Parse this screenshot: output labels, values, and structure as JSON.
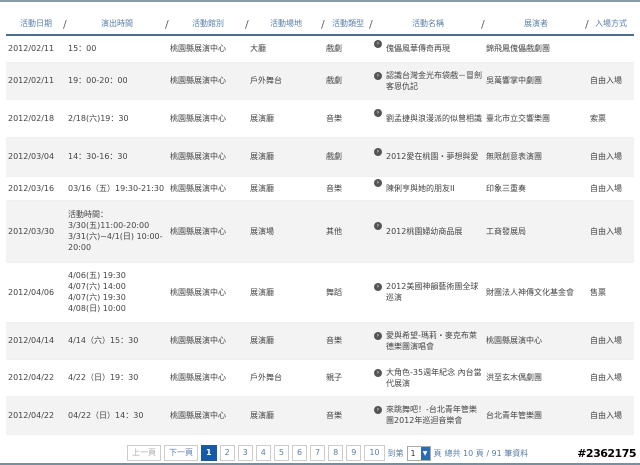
{
  "headers": [
    "活動日期",
    "演出時間",
    "活動館別",
    "活動場地",
    "活動類型",
    "活動名稱",
    "展演者",
    "入場方式"
  ],
  "rows": [
    {
      "date": "2012/02/11",
      "time": "15：00",
      "hall": "桃園縣展演中心",
      "venue": "大廳",
      "type": "戲劇",
      "name": "傀儡風華傳奇再現",
      "performer": "錦飛鳳傀儡戲劇團",
      "entry": ""
    },
    {
      "date": "2012/02/11",
      "time": "19：00-20：00",
      "hall": "桃園縣展演中心",
      "venue": "戶外舞台",
      "type": "戲劇",
      "name": "認識台灣金光布袋戲－冒劍客恩仇記",
      "performer": "吳萬響掌中劇團",
      "entry": "自由入場"
    },
    {
      "date": "2012/02/18",
      "time": "2/18(六)19：30",
      "hall": "桃園縣展演中心",
      "venue": "展演廳",
      "type": "音樂",
      "name": "劉孟捷與浪漫派的似曾相識",
      "performer": "臺北市立交響樂團",
      "entry": "索票"
    },
    {
      "date": "2012/03/04",
      "time": "14：30-16：30",
      "hall": "桃園縣展演中心",
      "venue": "展演廳",
      "type": "戲劇",
      "name": "2012愛在桃園・夢想與愛",
      "performer": "無限創意表演團",
      "entry": "自由入場"
    },
    {
      "date": "2012/03/16",
      "time": "03/16（五）19:30-21:30",
      "hall": "桃園縣展演中心",
      "venue": "展演廳",
      "type": "音樂",
      "name": "陳俐亨與她的朋友II",
      "performer": "印象三重奏",
      "entry": "自由入場"
    },
    {
      "date": "2012/03/30",
      "time": "活動時間：\n3/30(五)11:00-20:00\n3/31(六)~4/1(日) 10:00-20:00",
      "hall": "桃園縣展演中心",
      "venue": "展演場",
      "type": "其他",
      "name": "2012桃園婦幼商品展",
      "performer": "工商發展局",
      "entry": "自由入場"
    },
    {
      "date": "2012/04/06",
      "time": "4/06(五) 19:30\n4/07(六) 14:00\n4/07(六) 19:30\n4/08(日) 10:00",
      "hall": "桃園縣展演中心",
      "venue": "展演廳",
      "type": "舞蹈",
      "name": "2012美國神韻藝術團全球巡演",
      "performer": "財團法人神傳文化基金會",
      "entry": "售票"
    },
    {
      "date": "2012/04/14",
      "time": "4/14（六）15：30",
      "hall": "桃園縣展演中心",
      "venue": "展演廳",
      "type": "音樂",
      "name": "愛與希望-瑪莉・麥克布萊德樂團演唱會",
      "performer": "桃園縣展演中心",
      "entry": "自由入場"
    },
    {
      "date": "2012/04/22",
      "time": "4/22（日）19：30",
      "hall": "桃園縣展演中心",
      "venue": "戶外舞台",
      "type": "親子",
      "name": "大角色-35週年紀念 內台當代展演",
      "performer": "洪至玄木偶劇團",
      "entry": "自由入場"
    },
    {
      "date": "2012/04/22",
      "time": "04/22（日）14：30",
      "hall": "桃園縣展演中心",
      "venue": "展演廳",
      "type": "音樂",
      "name": "來跳舞吧！-台北青年管樂團2012年巡迴音樂會",
      "performer": "台北青年管樂團",
      "entry": "自由入場"
    }
  ],
  "pager": {
    "prev": "上一頁",
    "next": "下一頁",
    "pages": [
      "1",
      "2",
      "3",
      "4",
      "5",
      "6",
      "7",
      "8",
      "9",
      "10"
    ],
    "current": "1",
    "goto_label": "到第",
    "goto_value": "1",
    "page_unit": "頁",
    "summary": "總共 10 頁 / 91 筆資料"
  },
  "watermark": "#2362175"
}
